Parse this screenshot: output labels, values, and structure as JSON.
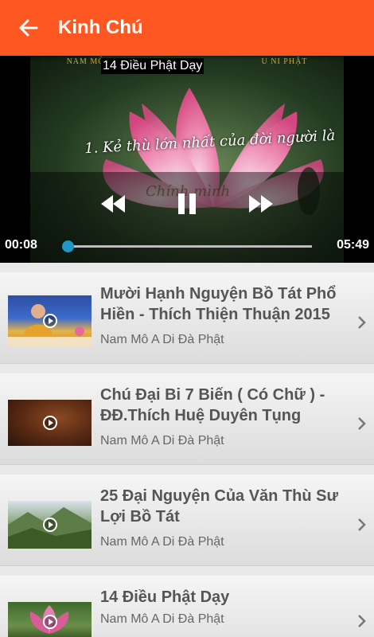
{
  "app_bar": {
    "title": "Kinh Chú",
    "back_icon": "arrow-back-icon",
    "color": "#ff5722"
  },
  "player": {
    "subtitle": "14 Điều Phật Dạy",
    "overlay_top_left": "NAM MÔ",
    "overlay_top_right": "U NI PHẬT",
    "video_text": "1. Kẻ thù lớn nhất của đời người là",
    "video_text_2": "Chính mình",
    "current_time": "00:08",
    "total_time": "05:49",
    "progress": 0.02,
    "accent": "#2196c8"
  },
  "videos": [
    {
      "title": "Mười Hạnh Nguyện Bồ Tát Phổ Hiền - Thích Thiện Thuận 2015",
      "channel": "Nam Mô A Di Đà Phật",
      "thumb": "monk-lecture"
    },
    {
      "title": "Chú Đại Bi 7 Biến ( Có Chữ ) - ĐĐ.Thích Huệ Duyên Tụng",
      "channel": "Nam Mô A Di Đà Phật",
      "thumb": "dark-temple"
    },
    {
      "title": "25 Đại Nguyện Của Văn Thù Sư Lợi Bồ Tát",
      "channel": "Nam Mô A Di Đà Phật",
      "thumb": "mountain-landscape"
    },
    {
      "title": "14 Điều Phật Dạy",
      "channel": "Nam Mô A Di Đà Phật",
      "thumb": "lotus-flower"
    }
  ]
}
